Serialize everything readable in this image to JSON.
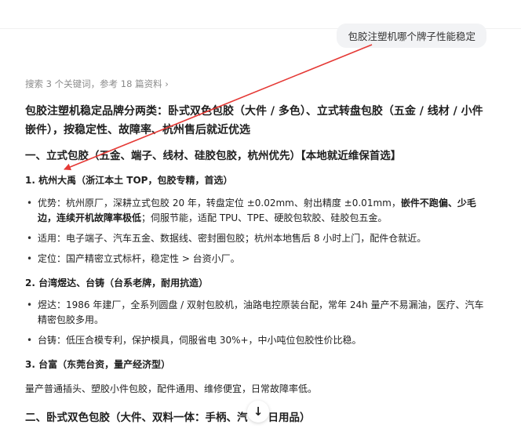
{
  "user_query": "包胶注塑机哪个牌子性能稳定",
  "search_meta": "搜索 3 个关键词，参考 18 篇资料 ›",
  "intro": "包胶注塑机稳定品牌分两类：卧式双色包胶（大件 / 多色）、立式转盘包胶（五金 / 线材 / 小件嵌件），按稳定性、故障率、杭州售后就近优选",
  "section1": {
    "title": "一、立式包胶（五金、端子、线材、硅胶包胶，杭州优先）【本地就近维保首选】",
    "brand1": {
      "title": "1. 杭州大禹（浙江本土 TOP，包胶专精，首选）",
      "b1_pre": "优势：杭州原厂，深耕立式包胶 20 年，转盘定位 ±0.02mm、射出精度 ±0.01mm，",
      "b1_bold": "嵌件不跑偏、少毛边，连续开机故障率极低",
      "b1_post": "；伺服节能，适配 TPU、TPE、硬胶包软胶、硅胶包五金。",
      "b2": "适用：电子端子、汽车五金、数据线、密封圈包胶；杭州本地售后 8 小时上门，配件仓就近。",
      "b3": "定位：国产精密立式标杆，稳定性 > 台资小厂。"
    },
    "brand2": {
      "title": "2. 台湾煜达、台铸（台系老牌，耐用抗造）",
      "b1": "煜达：1986 年建厂，全系列圆盘 / 双射包胶机，油路电控原装台配，常年 24h 量产不易漏油，医疗、汽车精密包胶多用。",
      "b2": "台铸：低压合模专利，保护模具，伺服省电 30%+，中小吨位包胶性价比稳。"
    },
    "brand3": {
      "title": "3. 台富（东莞台资，量产经济型）",
      "text": "量产普通插头、塑胶小件包胶，配件通用、维修便宜，日常故障率低。"
    }
  },
  "section2": {
    "title": "二、卧式双色包胶（大件、双料一体：手柄、汽",
    "title_tail": "日用品）"
  },
  "colors": {
    "annotation_arrow": "#e53935",
    "bubble_bg": "#f2f3f5",
    "meta_text": "#8a8a8a"
  },
  "icons": {
    "scroll_down": "arrow-down-icon"
  }
}
